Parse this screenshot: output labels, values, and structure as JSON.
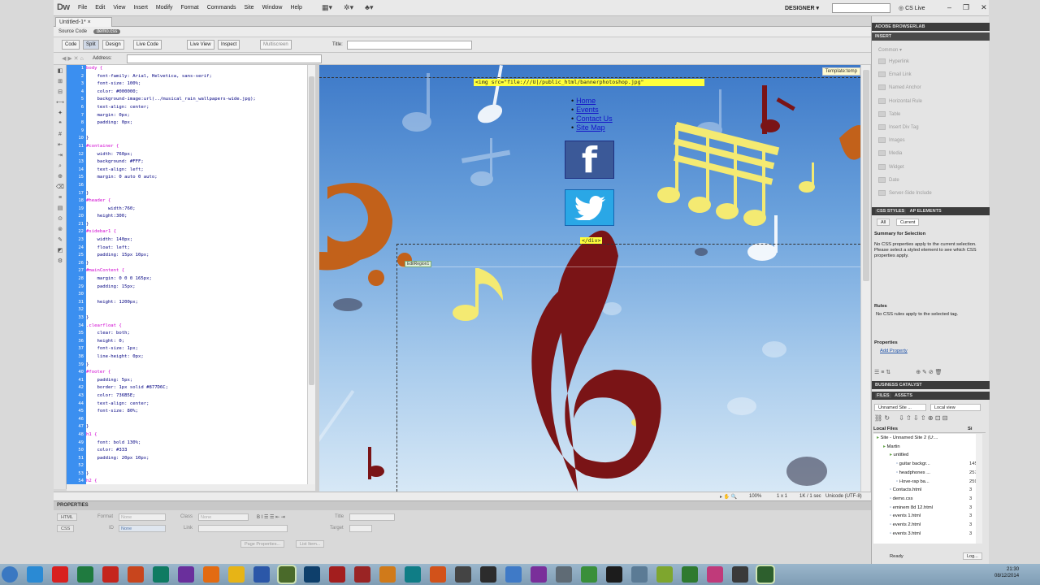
{
  "app": {
    "logo": "Dw",
    "menus": [
      "File",
      "Edit",
      "View",
      "Insert",
      "Modify",
      "Format",
      "Commands",
      "Site",
      "Window",
      "Help"
    ],
    "workspace": "DESIGNER",
    "cs_live": "CS Live"
  },
  "document": {
    "tab_label": "Untitled-1*",
    "source_code_label": "Source Code",
    "related_file": "demo.css"
  },
  "toolbar": {
    "code": "Code",
    "split": "Split",
    "design": "Design",
    "live_code": "Live Code",
    "live_view": "Live View",
    "inspect": "Inspect",
    "multiscreen": "Multiscreen",
    "title_label": "Title:",
    "address_label": "Address:"
  },
  "code_lines": [
    {
      "n": "1",
      "t": "body {",
      "sel": true
    },
    {
      "n": "2",
      "t": "    font-family: Arial, Helvetica, sans-serif;"
    },
    {
      "n": "3",
      "t": "    font-size: 100%;"
    },
    {
      "n": "4",
      "t": "    color: #000000;"
    },
    {
      "n": "5",
      "t": "    background-image:url(../musical_rain_wallpapers-wide.jpg);"
    },
    {
      "n": "6",
      "t": "    text-align: center;"
    },
    {
      "n": "7",
      "t": "    margin: 0px;"
    },
    {
      "n": "8",
      "t": "    padding: 0px;"
    },
    {
      "n": "9",
      "t": ""
    },
    {
      "n": "10",
      "t": "}"
    },
    {
      "n": "11",
      "t": "#container {",
      "sel": true
    },
    {
      "n": "12",
      "t": "    width: 760px;"
    },
    {
      "n": "13",
      "t": "    background: #FFF;"
    },
    {
      "n": "14",
      "t": "    text-align: left;"
    },
    {
      "n": "15",
      "t": "    margin: 0 auto 0 auto;"
    },
    {
      "n": "16",
      "t": ""
    },
    {
      "n": "17",
      "t": "}"
    },
    {
      "n": "18",
      "t": "#header {",
      "sel": true
    },
    {
      "n": "19",
      "t": "        width:760;"
    },
    {
      "n": "20",
      "t": "    height:300;"
    },
    {
      "n": "21",
      "t": "}"
    },
    {
      "n": "22",
      "t": "#sidebar1 {",
      "sel": true
    },
    {
      "n": "23",
      "t": "    width: 140px;"
    },
    {
      "n": "24",
      "t": "    float: left;"
    },
    {
      "n": "25",
      "t": "    padding: 15px 10px;"
    },
    {
      "n": "26",
      "t": "}"
    },
    {
      "n": "27",
      "t": "#mainContent {",
      "sel": true
    },
    {
      "n": "28",
      "t": "    margin: 0 0 0 165px;"
    },
    {
      "n": "29",
      "t": "    padding: 15px;"
    },
    {
      "n": "30",
      "t": ""
    },
    {
      "n": "31",
      "t": "    height: 1200px;"
    },
    {
      "n": "32",
      "t": ""
    },
    {
      "n": "33",
      "t": "}"
    },
    {
      "n": "34",
      "t": ".clearfloat {",
      "sel": true
    },
    {
      "n": "35",
      "t": "    clear: both;"
    },
    {
      "n": "36",
      "t": "    height: 0;"
    },
    {
      "n": "37",
      "t": "    font-size: 1px;"
    },
    {
      "n": "38",
      "t": "    line-height: 0px;"
    },
    {
      "n": "39",
      "t": "}"
    },
    {
      "n": "40",
      "t": "#footer {",
      "sel": true
    },
    {
      "n": "41",
      "t": "    padding: 5px;"
    },
    {
      "n": "42",
      "t": "    border: 1px solid #877D6C;"
    },
    {
      "n": "43",
      "t": "    color: 736B5E;"
    },
    {
      "n": "44",
      "t": "    text-align: center;"
    },
    {
      "n": "45",
      "t": "    font-size: 80%;"
    },
    {
      "n": "46",
      "t": ""
    },
    {
      "n": "47",
      "t": "}"
    },
    {
      "n": "48",
      "t": "h1 {",
      "sel": true
    },
    {
      "n": "49",
      "t": "    font: bold 130%;"
    },
    {
      "n": "50",
      "t": "    color: #333"
    },
    {
      "n": "51",
      "t": "    padding: 20px 10px;"
    },
    {
      "n": "52",
      "t": ""
    },
    {
      "n": "53",
      "t": "}"
    },
    {
      "n": "54",
      "t": "h2 {",
      "sel": true
    }
  ],
  "design_view": {
    "template_tag": "Template:temp",
    "img_tag": "<img src=\"file:///U|/public_html/bannerphotoshop.jpg\"",
    "nav_links": [
      "Home",
      "Events",
      "Contact Us",
      "Site Map"
    ],
    "div_close": "</div>",
    "editable_region": "EditRegion1",
    "facebook_glyph": "f"
  },
  "statusbar": {
    "zoom": "100%",
    "size": "1 x 1",
    "download": "1K / 1 sec",
    "encoding": "Unicode (UTF-8)"
  },
  "properties": {
    "header": "PROPERTIES",
    "html_btn": "HTML",
    "css_btn": "CSS",
    "format_label": "Format",
    "format_value": "None",
    "class_label": "Class",
    "class_value": "None",
    "title_label": "Title",
    "id_label": "ID",
    "id_value": "None",
    "link_label": "Link",
    "target_label": "Target",
    "page_properties": "Page Properties...",
    "list_item": "List Item..."
  },
  "right_panel": {
    "browserlab": "ADOBE BROWSERLAB",
    "insert": "INSERT",
    "insert_category": "Common",
    "insert_items": [
      "Hyperlink",
      "Email Link",
      "Named Anchor",
      "Horizontal Rule",
      "Table",
      "Insert Div Tag",
      "Images",
      "Media",
      "Widget",
      "Date",
      "Server-Side Include"
    ],
    "css_styles_tab": "CSS STYLES",
    "ap_elements_tab": "AP ELEMENTS",
    "all_btn": "All",
    "current_btn": "Current",
    "summary_title": "Summary for Selection",
    "summary_text": "No CSS properties apply to the current selection. Please select a styled element to see which CSS properties apply.",
    "rules_title": "Rules",
    "rules_text": "No CSS rules apply to the selected tag.",
    "properties_title": "Properties",
    "add_property": "Add Property",
    "business_catalyst": "BUSINESS CATALYST",
    "files_tab": "FILES",
    "assets_tab": "ASSETS",
    "site_select": "Unnamed Site ...",
    "view_select": "Local view",
    "local_files_header": "Local Files",
    "size_header": "Si",
    "files": [
      {
        "name": "Site - Unnamed Site 2 (U:...",
        "size": "",
        "indent": 0
      },
      {
        "name": "Martin",
        "size": "",
        "indent": 1
      },
      {
        "name": "untitled",
        "size": "",
        "indent": 2
      },
      {
        "name": "guitar backgr...",
        "size": "145",
        "indent": 3
      },
      {
        "name": "headphones ...",
        "size": "257",
        "indent": 3
      },
      {
        "name": "i-love-rap ba...",
        "size": "259",
        "indent": 3
      },
      {
        "name": "Contacts.html",
        "size": "3",
        "indent": 2
      },
      {
        "name": "demo.css",
        "size": "3",
        "indent": 2
      },
      {
        "name": "eminem 8d 12.html",
        "size": "3",
        "indent": 2
      },
      {
        "name": "events 1.html",
        "size": "3",
        "indent": 2
      },
      {
        "name": "events 2.html",
        "size": "3",
        "indent": 2
      },
      {
        "name": "events 3.html",
        "size": "3",
        "indent": 2
      }
    ],
    "ready": "Ready",
    "log_btn": "Log..."
  },
  "taskbar": {
    "time": "21:30",
    "date": "08/12/2014",
    "apps": [
      {
        "name": "start-orb",
        "color": "#3a78c2"
      },
      {
        "name": "ie",
        "color": "#2a8ad4"
      },
      {
        "name": "opera",
        "color": "#d8201f"
      },
      {
        "name": "excel",
        "color": "#1f7a3f"
      },
      {
        "name": "acrobat",
        "color": "#c5251d"
      },
      {
        "name": "powerpoint",
        "color": "#c8451d"
      },
      {
        "name": "publisher",
        "color": "#0f7b62"
      },
      {
        "name": "visual-studio",
        "color": "#6a2f9c"
      },
      {
        "name": "firefox",
        "color": "#e36b12"
      },
      {
        "name": "chrome",
        "color": "#e7b416"
      },
      {
        "name": "word",
        "color": "#2b57a8"
      },
      {
        "name": "dreamweaver",
        "color": "#4a6a2a"
      },
      {
        "name": "photoshop",
        "color": "#0e3f6b"
      },
      {
        "name": "flash",
        "color": "#a31e1e"
      },
      {
        "name": "director",
        "color": "#9a2424"
      },
      {
        "name": "matlab",
        "color": "#d07a1a"
      },
      {
        "name": "app-teal",
        "color": "#0f7d86"
      },
      {
        "name": "app-orange",
        "color": "#d2521a"
      },
      {
        "name": "unity",
        "color": "#444444"
      },
      {
        "name": "app-dark",
        "color": "#2c2c2c"
      },
      {
        "name": "app-blue",
        "color": "#3f7ac7"
      },
      {
        "name": "app-purple",
        "color": "#7a2f9a"
      },
      {
        "name": "app-grey",
        "color": "#5f6b75"
      },
      {
        "name": "app-green",
        "color": "#3a8f3a"
      },
      {
        "name": "terminal",
        "color": "#1c1c1c"
      },
      {
        "name": "app-steel",
        "color": "#5b7b95"
      },
      {
        "name": "app-lime",
        "color": "#7ea62e"
      },
      {
        "name": "app-green2",
        "color": "#2f7a2f"
      },
      {
        "name": "app-pink",
        "color": "#c03a7a"
      },
      {
        "name": "app-dark2",
        "color": "#3a3a3a"
      },
      {
        "name": "app-active",
        "color": "#2d5f2d"
      }
    ]
  }
}
